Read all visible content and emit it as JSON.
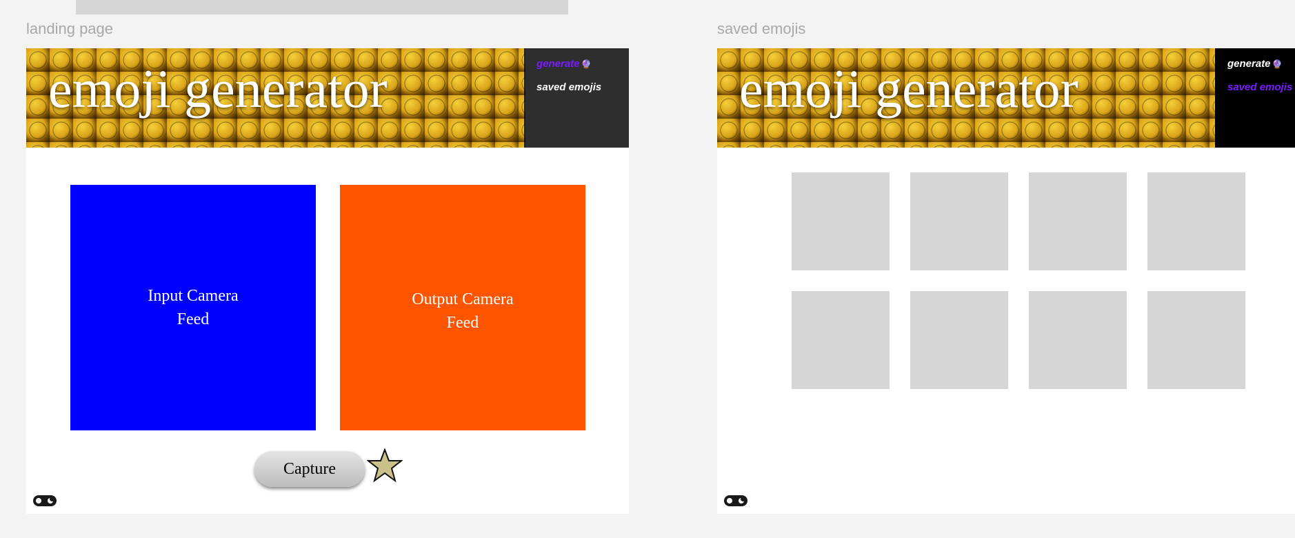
{
  "frames": {
    "landing": {
      "label": "landing page",
      "title": "emoji generator",
      "nav": {
        "generate": "generate",
        "saved": "saved emojis",
        "generate_icon": "crystal-ball-icon"
      },
      "input_feed": {
        "line1": "Input Camera",
        "line2": "Feed",
        "color": "#0000ff"
      },
      "output_feed": {
        "line1": "Output Camera",
        "line2": "Feed",
        "color": "#ff5500"
      },
      "capture_label": "Capture",
      "active_nav": "generate"
    },
    "saved": {
      "label": "saved emojis",
      "title": "emoji generator",
      "nav": {
        "generate": "generate",
        "saved": "saved emojis",
        "generate_icon": "crystal-ball-icon"
      },
      "active_nav": "saved emojis",
      "tiles": [
        "",
        "",
        "",
        "",
        "",
        "",
        "",
        ""
      ]
    }
  },
  "colors": {
    "accent": "#7a1cff",
    "frame_bg": "#ffffff",
    "canvas_bg": "#f3f3f3",
    "tile": "#d6d6d6"
  }
}
